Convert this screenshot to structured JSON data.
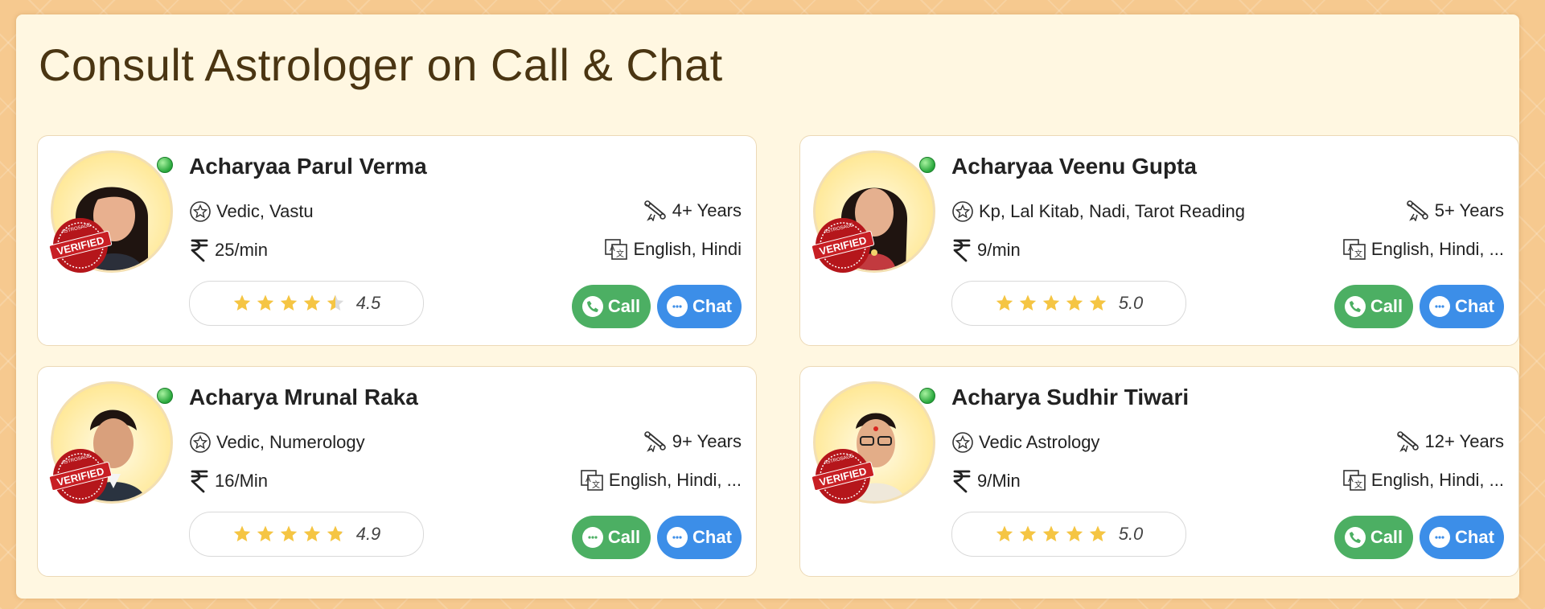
{
  "page": {
    "title": "Consult Astrologer on Call & Chat"
  },
  "colors": {
    "accent_call": "#4caf63",
    "accent_chat": "#3c8ee8",
    "star": "#f5c543",
    "online": "#27a63b"
  },
  "astrologers": [
    {
      "name": "Acharyaa Parul Verma",
      "skills": "Vedic, Vastu",
      "experience": "4+ Years",
      "price": "25/min",
      "languages": "English, Hindi",
      "rating": 4.5,
      "rating_text": "4.5",
      "call_label": "Call",
      "chat_label": "Chat",
      "badge": "VERIFIED",
      "badge_ring": "ASTROSAGE"
    },
    {
      "name": "Acharyaa Veenu Gupta",
      "skills": "Kp, Lal Kitab, Nadi, Tarot Reading",
      "experience": "5+ Years",
      "price": "9/min",
      "languages": "English, Hindi, ...",
      "rating": 5.0,
      "rating_text": "5.0",
      "call_label": "Call",
      "chat_label": "Chat",
      "badge": "VERIFIED",
      "badge_ring": "ASTROSAGE"
    },
    {
      "name": "Acharya Mrunal Raka",
      "skills": "Vedic, Numerology",
      "experience": "9+ Years",
      "price": "16/Min",
      "languages": "English, Hindi, ...",
      "rating": 4.9,
      "rating_text": "4.9",
      "call_label": "Call",
      "chat_label": "Chat",
      "badge": "VERIFIED",
      "badge_ring": "ASTROSAGE"
    },
    {
      "name": "Acharya Sudhir Tiwari",
      "skills": "Vedic Astrology",
      "experience": "12+ Years",
      "price": "9/Min",
      "languages": "English, Hindi, ...",
      "rating": 5.0,
      "rating_text": "5.0",
      "call_label": "Call",
      "chat_label": "Chat",
      "badge": "VERIFIED",
      "badge_ring": "ASTROSAGE"
    }
  ],
  "icons": {
    "skills": "star-circle-icon",
    "experience": "scroll-icon",
    "price": "rupee-icon",
    "languages": "translate-icon",
    "call": "phone-icon",
    "chat": "chat-bubble-icon",
    "online": "online-dot-icon"
  }
}
